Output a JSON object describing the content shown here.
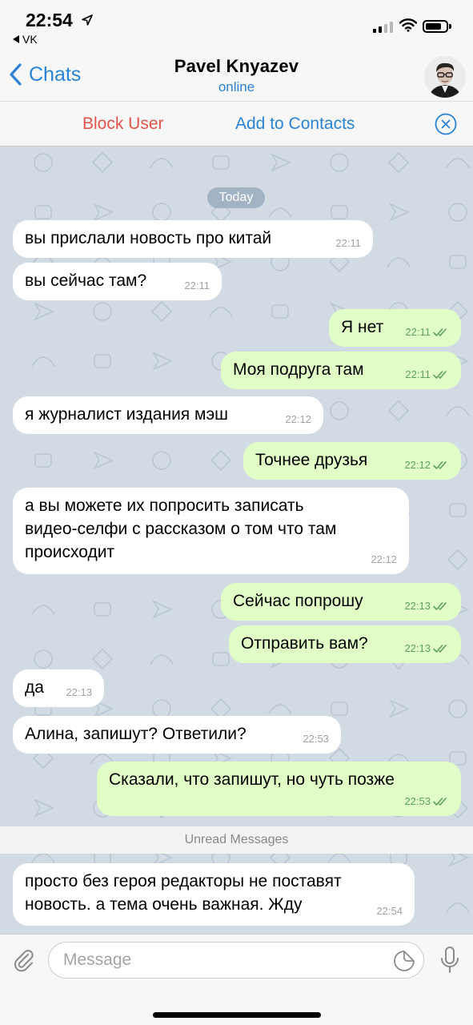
{
  "status_bar": {
    "time": "22:54",
    "back_app": "VK"
  },
  "nav": {
    "back_label": "Chats",
    "title": "Pavel Knyazev",
    "subtitle": "online"
  },
  "actions": {
    "block_label": "Block User",
    "add_label": "Add to Contacts"
  },
  "chat": {
    "date_label": "Today",
    "unread_label": "Unread Messages",
    "messages": [
      {
        "dir": "in",
        "text": [
          "вы прислали новость про китай"
        ],
        "time": "22:11"
      },
      {
        "dir": "in",
        "text": [
          "вы сейчас там?"
        ],
        "time": "22:11"
      },
      {
        "dir": "out",
        "text": [
          "Я нет"
        ],
        "time": "22:11"
      },
      {
        "dir": "out",
        "text": [
          "Моя подруга там"
        ],
        "time": "22:11"
      },
      {
        "dir": "in",
        "text": [
          "я журналист издания мэш"
        ],
        "time": "22:12"
      },
      {
        "dir": "out",
        "text": [
          "Точнее друзья"
        ],
        "time": "22:12"
      },
      {
        "dir": "in",
        "text": [
          "а вы можете их попросить записать",
          "видео-селфи с рассказом о том что там",
          "происходит"
        ],
        "time": "22:12"
      },
      {
        "dir": "out",
        "text": [
          "Сейчас попрошу"
        ],
        "time": "22:13"
      },
      {
        "dir": "out",
        "text": [
          "Отправить вам?"
        ],
        "time": "22:13"
      },
      {
        "dir": "in",
        "text": [
          "да"
        ],
        "time": "22:13"
      },
      {
        "dir": "in",
        "text": [
          "Алина, запишут? Ответили?"
        ],
        "time": "22:53"
      },
      {
        "dir": "out",
        "text": [
          "Сказали, что запишут, но чуть позже"
        ],
        "time": "22:53"
      },
      {
        "dir": "in",
        "text": [
          "просто без героя редакторы не поставят",
          "новость. а тема очень важная. Жду"
        ],
        "time": "22:54"
      }
    ]
  },
  "input": {
    "placeholder": "Message"
  },
  "colors": {
    "accent": "#2a83d6",
    "danger": "#e3534c",
    "incoming_bubble": "#ffffff",
    "outgoing_bubble": "#e1fec6",
    "outgoing_meta": "#5ea05c",
    "chat_background": "#d2dbe4"
  },
  "icons": {
    "location": "location-arrow-icon",
    "signal": "cellular-signal-icon",
    "wifi": "wifi-icon",
    "battery": "battery-icon",
    "back": "chevron-left-icon",
    "close": "close-circle-icon",
    "attach": "paperclip-icon",
    "sticker": "sticker-icon",
    "mic": "microphone-icon",
    "read": "double-check-icon"
  }
}
